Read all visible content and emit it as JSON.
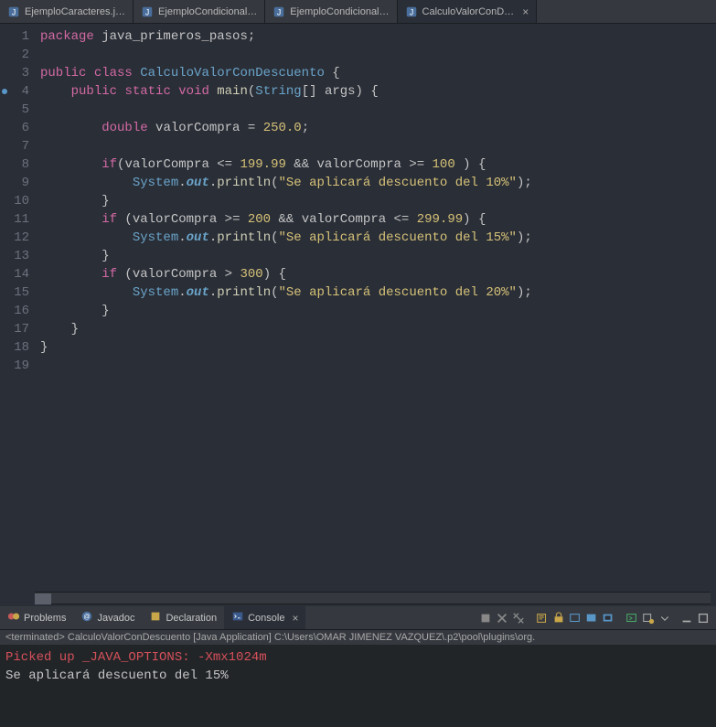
{
  "tabs": [
    {
      "label": "EjemploCaracteres.j…",
      "active": false
    },
    {
      "label": "EjemploCondicional…",
      "active": false
    },
    {
      "label": "EjemploCondicional…",
      "active": false
    },
    {
      "label": "CalculoValorConD…",
      "active": true
    }
  ],
  "lines": [
    {
      "n": 1,
      "tokens": [
        [
          "kw",
          "package"
        ],
        [
          "pun",
          " "
        ],
        [
          "id",
          "java_primeros_pasos"
        ],
        [
          "pun",
          ";"
        ]
      ]
    },
    {
      "n": 2,
      "tokens": []
    },
    {
      "n": 3,
      "tokens": [
        [
          "kw",
          "public"
        ],
        [
          "pun",
          " "
        ],
        [
          "kw",
          "class"
        ],
        [
          "pun",
          " "
        ],
        [
          "cls",
          "CalculoValorConDescuento"
        ],
        [
          "pun",
          " {"
        ]
      ]
    },
    {
      "n": 4,
      "bp": true,
      "tokens": [
        [
          "pun",
          "    "
        ],
        [
          "kw",
          "public"
        ],
        [
          "pun",
          " "
        ],
        [
          "kw",
          "static"
        ],
        [
          "pun",
          " "
        ],
        [
          "kw",
          "void"
        ],
        [
          "pun",
          " "
        ],
        [
          "mth",
          "main"
        ],
        [
          "pun",
          "("
        ],
        [
          "type",
          "String"
        ],
        [
          "pun",
          "[] "
        ],
        [
          "id",
          "args"
        ],
        [
          "pun",
          ") {"
        ]
      ]
    },
    {
      "n": 5,
      "tokens": []
    },
    {
      "n": 6,
      "tokens": [
        [
          "pun",
          "        "
        ],
        [
          "kw",
          "double"
        ],
        [
          "pun",
          " "
        ],
        [
          "id",
          "valorCompra"
        ],
        [
          "pun",
          " = "
        ],
        [
          "num",
          "250.0"
        ],
        [
          "pun",
          ";"
        ]
      ]
    },
    {
      "n": 7,
      "tokens": []
    },
    {
      "n": 8,
      "tokens": [
        [
          "pun",
          "        "
        ],
        [
          "kw",
          "if"
        ],
        [
          "pun",
          "("
        ],
        [
          "id",
          "valorCompra"
        ],
        [
          "pun",
          " <= "
        ],
        [
          "num",
          "199.99"
        ],
        [
          "pun",
          " && "
        ],
        [
          "id",
          "valorCompra"
        ],
        [
          "pun",
          " >= "
        ],
        [
          "num",
          "100"
        ],
        [
          "pun",
          " ) {"
        ]
      ]
    },
    {
      "n": 9,
      "tokens": [
        [
          "pun",
          "            "
        ],
        [
          "type",
          "System"
        ],
        [
          "pun",
          "."
        ],
        [
          "fld",
          "out"
        ],
        [
          "pun",
          "."
        ],
        [
          "mth",
          "println"
        ],
        [
          "pun",
          "("
        ],
        [
          "str",
          "\"Se aplicará descuento del 10%\""
        ],
        [
          "pun",
          ");"
        ]
      ]
    },
    {
      "n": 10,
      "tokens": [
        [
          "pun",
          "        }"
        ]
      ]
    },
    {
      "n": 11,
      "tokens": [
        [
          "pun",
          "        "
        ],
        [
          "kw",
          "if"
        ],
        [
          "pun",
          " ("
        ],
        [
          "id",
          "valorCompra"
        ],
        [
          "pun",
          " >= "
        ],
        [
          "num",
          "200"
        ],
        [
          "pun",
          " && "
        ],
        [
          "id",
          "valorCompra"
        ],
        [
          "pun",
          " <= "
        ],
        [
          "num",
          "299.99"
        ],
        [
          "pun",
          ") {"
        ]
      ]
    },
    {
      "n": 12,
      "tokens": [
        [
          "pun",
          "            "
        ],
        [
          "type",
          "System"
        ],
        [
          "pun",
          "."
        ],
        [
          "fld",
          "out"
        ],
        [
          "pun",
          "."
        ],
        [
          "mth",
          "println"
        ],
        [
          "pun",
          "("
        ],
        [
          "str",
          "\"Se aplicará descuento del 15%\""
        ],
        [
          "pun",
          ");"
        ]
      ]
    },
    {
      "n": 13,
      "tokens": [
        [
          "pun",
          "        }"
        ]
      ]
    },
    {
      "n": 14,
      "tokens": [
        [
          "pun",
          "        "
        ],
        [
          "kw",
          "if"
        ],
        [
          "pun",
          " ("
        ],
        [
          "id",
          "valorCompra"
        ],
        [
          "pun",
          " > "
        ],
        [
          "num",
          "300"
        ],
        [
          "pun",
          ") {"
        ]
      ]
    },
    {
      "n": 15,
      "tokens": [
        [
          "pun",
          "            "
        ],
        [
          "type",
          "System"
        ],
        [
          "pun",
          "."
        ],
        [
          "fld",
          "out"
        ],
        [
          "pun",
          "."
        ],
        [
          "mth",
          "println"
        ],
        [
          "pun",
          "("
        ],
        [
          "str",
          "\"Se aplicará descuento del 20%\""
        ],
        [
          "pun",
          ");"
        ]
      ]
    },
    {
      "n": 16,
      "tokens": [
        [
          "pun",
          "        }"
        ]
      ]
    },
    {
      "n": 17,
      "tokens": [
        [
          "pun",
          "    }"
        ]
      ]
    },
    {
      "n": 18,
      "tokens": [
        [
          "pun",
          "}"
        ]
      ]
    },
    {
      "n": 19,
      "tokens": []
    }
  ],
  "bottomTabs": [
    {
      "label": "Problems",
      "icon": "problems"
    },
    {
      "label": "Javadoc",
      "icon": "doc"
    },
    {
      "label": "Declaration",
      "icon": "decl"
    },
    {
      "label": "Console",
      "icon": "console",
      "active": true
    }
  ],
  "consoleStatus": "<terminated> CalculoValorConDescuento [Java Application] C:\\Users\\OMAR JIMENEZ VAZQUEZ\\.p2\\pool\\plugins\\org.",
  "consoleLines": [
    {
      "cls": "red",
      "text": "Picked up _JAVA_OPTIONS: -Xmx1024m"
    },
    {
      "cls": "plain",
      "text": "Se aplicará descuento del 15%"
    }
  ]
}
